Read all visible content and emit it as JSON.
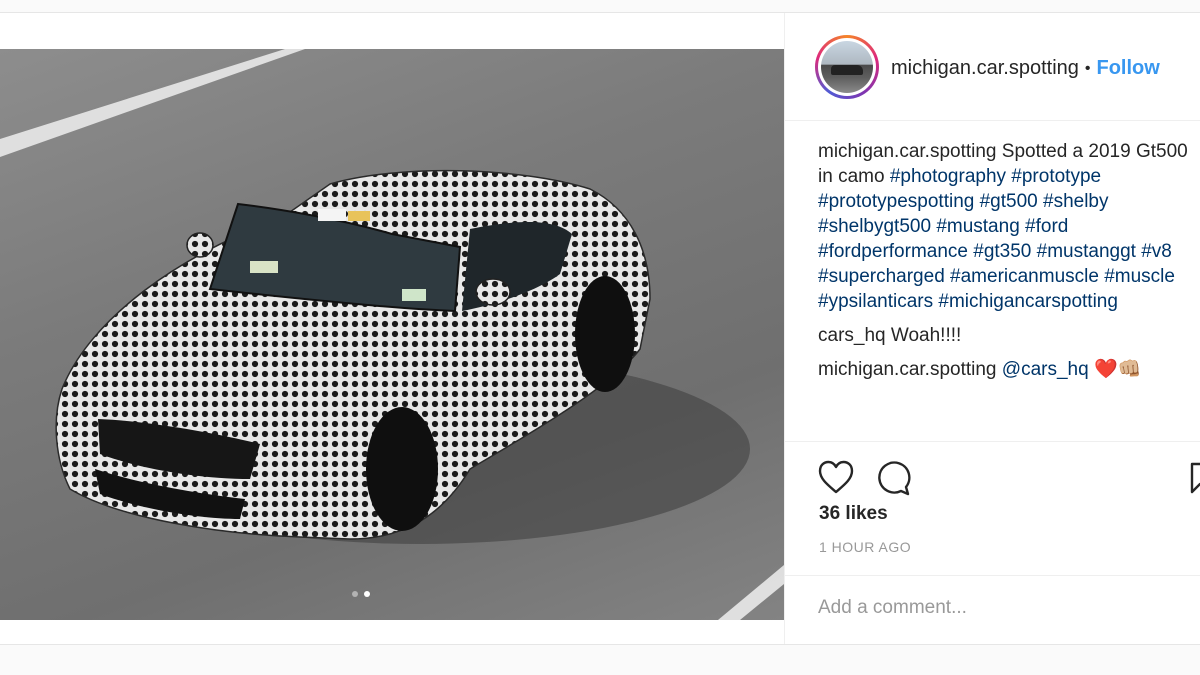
{
  "post": {
    "username": "michigan.car.spotting",
    "bullet": "•",
    "follow_label": "Follow",
    "caption_text": "Spotted a 2019 Gt500 in camo",
    "hashtags": "#photography #prototype #prototypespotting #gt500 #shelby #shelbygt500 #mustang #ford #fordperformance #gt350 #mustanggt #v8 #supercharged #americanmuscle #muscle #ypsilanticars #michigancarspotting",
    "comments": [
      {
        "user": "cars_hq",
        "text": "Woah!!!!"
      },
      {
        "user": "michigan.car.spotting",
        "mention": "@cars_hq",
        "emoji": "❤️👊🏼"
      }
    ],
    "likes": "36 likes",
    "time": "1 HOUR AGO",
    "add_comment_placeholder": "Add a comment...",
    "carousel": {
      "count": 2,
      "active_index": 1
    }
  },
  "icons": {
    "like": "heart-icon",
    "comment": "comment-bubble-icon",
    "save": "bookmark-icon"
  },
  "colors": {
    "link_blue": "#3897f0",
    "hashtag_blue": "#003569",
    "muted_text": "#999999",
    "heart_red": "#e0245e"
  }
}
